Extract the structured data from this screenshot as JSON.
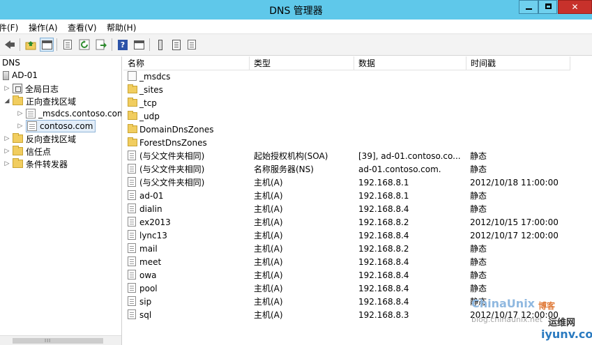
{
  "window": {
    "title": "DNS 管理器",
    "min_glyph": "",
    "max_glyph": "",
    "close_glyph": "✕"
  },
  "menu": [
    "件(F)",
    "操作(A)",
    "查看(V)",
    "帮助(H)"
  ],
  "toolbar": {
    "buttons": [
      "back-arrow-icon",
      "up-folder-icon",
      "show-hide-tree-icon",
      "properties-icon",
      "refresh-icon",
      "export-list-icon",
      "help-icon",
      "show-hide-action-pane-icon",
      "server-icon",
      "zone-list-icon",
      "zone-icon"
    ]
  },
  "tree": {
    "root": "DNS",
    "server": "AD-01",
    "global_logs": "全局日志",
    "forward_zones": "正向查找区域",
    "zone_msdcs": "_msdcs.contoso.com",
    "zone_contoso": "contoso.com",
    "reverse_zones": "反向查找区域",
    "trust_points": "信任点",
    "conditional_forwarders": "条件转发器"
  },
  "list": {
    "columns": [
      "名称",
      "类型",
      "数据",
      "时间戳"
    ],
    "folders": [
      "_msdcs",
      "_sites",
      "_tcp",
      "_udp",
      "DomainDnsZones",
      "ForestDnsZones"
    ],
    "records": [
      {
        "name": "(与父文件夹相同)",
        "type": "起始授权机构(SOA)",
        "data": "[39], ad-01.contoso.co...",
        "timestamp": "静态"
      },
      {
        "name": "(与父文件夹相同)",
        "type": "名称服务器(NS)",
        "data": "ad-01.contoso.com.",
        "timestamp": "静态"
      },
      {
        "name": "(与父文件夹相同)",
        "type": "主机(A)",
        "data": "192.168.8.1",
        "timestamp": "2012/10/18 11:00:00"
      },
      {
        "name": "ad-01",
        "type": "主机(A)",
        "data": "192.168.8.1",
        "timestamp": "静态"
      },
      {
        "name": "dialin",
        "type": "主机(A)",
        "data": "192.168.8.4",
        "timestamp": "静态"
      },
      {
        "name": "ex2013",
        "type": "主机(A)",
        "data": "192.168.8.2",
        "timestamp": "2012/10/15 17:00:00"
      },
      {
        "name": "lync13",
        "type": "主机(A)",
        "data": "192.168.8.4",
        "timestamp": "2012/10/17 12:00:00"
      },
      {
        "name": "mail",
        "type": "主机(A)",
        "data": "192.168.8.2",
        "timestamp": "静态"
      },
      {
        "name": "meet",
        "type": "主机(A)",
        "data": "192.168.8.4",
        "timestamp": "静态"
      },
      {
        "name": "owa",
        "type": "主机(A)",
        "data": "192.168.8.4",
        "timestamp": "静态"
      },
      {
        "name": "pool",
        "type": "主机(A)",
        "data": "192.168.8.4",
        "timestamp": "静态"
      },
      {
        "name": "sip",
        "type": "主机(A)",
        "data": "192.168.8.4",
        "timestamp": "静态"
      },
      {
        "name": "sql",
        "type": "主机(A)",
        "data": "192.168.8.3",
        "timestamp": "2012/10/17 12:00:00"
      }
    ]
  },
  "scrollbar": {
    "grip": "III"
  },
  "watermark": {
    "brand": "ChinaUnix",
    "brand_cn": "博客",
    "blog": "blog.chinaunix.net",
    "site_cn": "运维网",
    "site": "iyunv.com"
  },
  "colors": {
    "titlebar": "#5fc8ea",
    "close_button": "#c7312b",
    "toolbar": "#f3f3f3",
    "folder": "#f1cd5f"
  }
}
